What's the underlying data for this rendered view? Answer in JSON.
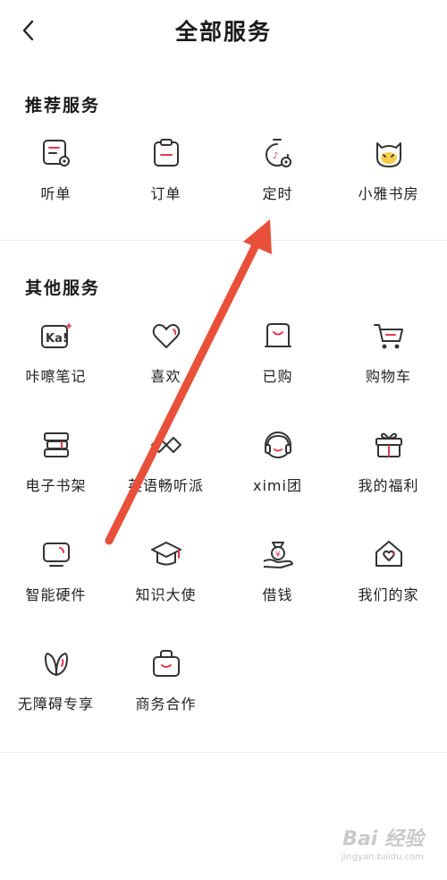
{
  "header": {
    "title": "全部服务",
    "back_icon": "chevron-left-icon"
  },
  "sections": [
    {
      "title": "推荐服务",
      "items": [
        {
          "label": "听单",
          "icon": "playlist-icon"
        },
        {
          "label": "订单",
          "icon": "clipboard-icon"
        },
        {
          "label": "定时",
          "icon": "timer-icon"
        },
        {
          "label": "小雅书房",
          "icon": "cat-mascot-icon"
        }
      ]
    },
    {
      "title": "其他服务",
      "items": [
        {
          "label": "咔嚓笔记",
          "icon": "ka-note-icon"
        },
        {
          "label": "喜欢",
          "icon": "heart-icon"
        },
        {
          "label": "已购",
          "icon": "purchased-icon"
        },
        {
          "label": "购物车",
          "icon": "cart-icon"
        },
        {
          "label": "电子书架",
          "icon": "bookshelf-icon"
        },
        {
          "label": "英语畅听派",
          "icon": "link-icon"
        },
        {
          "label": "ximi团",
          "icon": "headphone-avatar-icon"
        },
        {
          "label": "我的福利",
          "icon": "gift-icon"
        },
        {
          "label": "智能硬件",
          "icon": "tv-icon"
        },
        {
          "label": "知识大使",
          "icon": "graduation-cap-icon"
        },
        {
          "label": "借钱",
          "icon": "money-hand-icon"
        },
        {
          "label": "我们的家",
          "icon": "house-heart-icon"
        },
        {
          "label": "无障碍专享",
          "icon": "leaf-icon"
        },
        {
          "label": "商务合作",
          "icon": "briefcase-icon"
        }
      ]
    }
  ],
  "watermark": {
    "main": "Bai 经验",
    "sub": "jingyan.baidu.com"
  },
  "colors": {
    "accent": "#e8384f",
    "icon_stroke": "#333333",
    "arrow": "#e8503a",
    "divider": "#eeeeee"
  }
}
